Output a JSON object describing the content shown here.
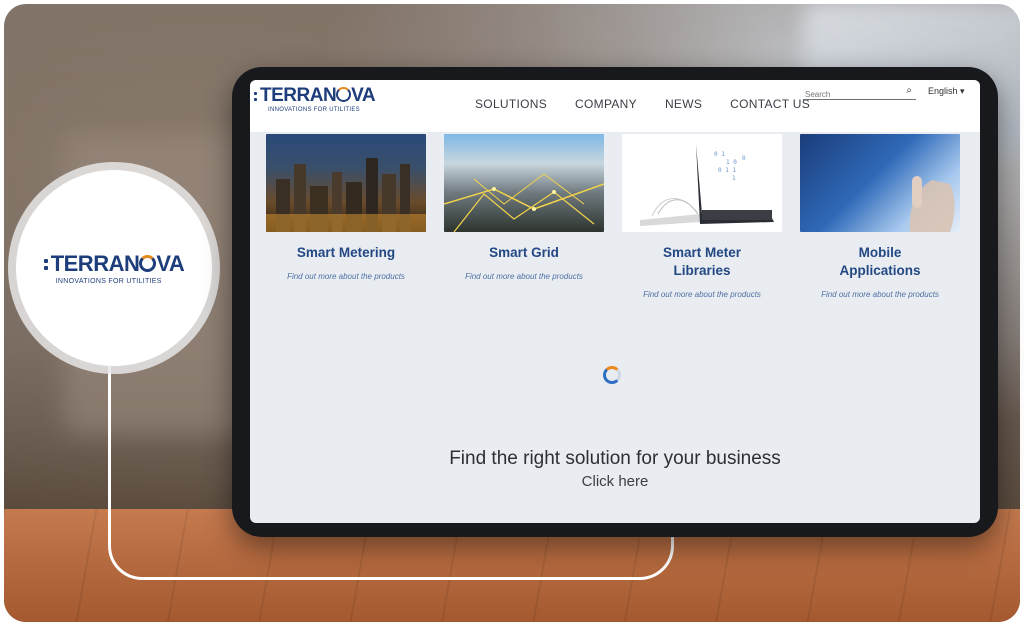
{
  "brand": {
    "logo_name": "TERRAN",
    "logo_o": "O",
    "logo_tail": "VA",
    "tagline": "INNOVATIONS FOR UTILITIES",
    "primary_color": "#1e3d7b",
    "accent_color": "#e58a1f"
  },
  "nav": {
    "items": [
      "SOLUTIONS",
      "COMPANY",
      "NEWS",
      "CONTACT US"
    ]
  },
  "search": {
    "placeholder": "Search",
    "icon": "search-icon"
  },
  "language": {
    "selected": "English",
    "caret": "▾"
  },
  "cards": [
    {
      "title": "Smart Metering",
      "link": "Find out more about the products"
    },
    {
      "title": "Smart Grid",
      "link": "Find out more about the products"
    },
    {
      "title": "Smart Meter Libraries",
      "link": "Find out more about the products"
    },
    {
      "title": "Mobile Applications",
      "link": "Find out more about the products"
    }
  ],
  "cta": {
    "title": "Find the right solution for your business",
    "link": "Click here"
  }
}
